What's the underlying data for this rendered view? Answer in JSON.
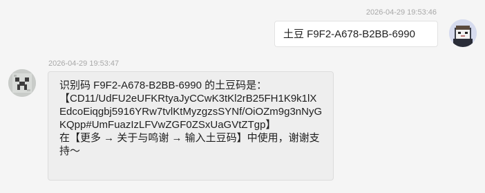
{
  "conversation": {
    "outgoing": {
      "timestamp": "2026-04-29 19:53:46",
      "text": "土豆 F9F2-A678-B2BB-6990"
    },
    "incoming": {
      "timestamp": "2026-04-29 19:53:47",
      "line1": "识别码 F9F2-A678-B2BB-6990 的土豆码是：",
      "code": "【CD11/UdFU2eUFKRtyaJyCCwK3tKl2rB25FH1K9k1lXEdcoEiqgbj5916YRw7tvlKtMyzgzsSYNf/OiOZm9g3nNyGKQpp#UmFuazIzLFVwZGF0ZSxUaGVtZTgp】",
      "line3": "在【更多 → 关于与鸣谢 → 输入土豆码】中使用，谢谢支持～"
    }
  },
  "icons": {
    "outgoing_avatar": "user-avatar-icon",
    "incoming_avatar": "bot-avatar-icon"
  },
  "colors": {
    "background": "#f5f5f5",
    "outgoing_bubble": "#ffffff",
    "incoming_bubble": "#eeeeee",
    "timestamp": "#a8a8a8"
  }
}
